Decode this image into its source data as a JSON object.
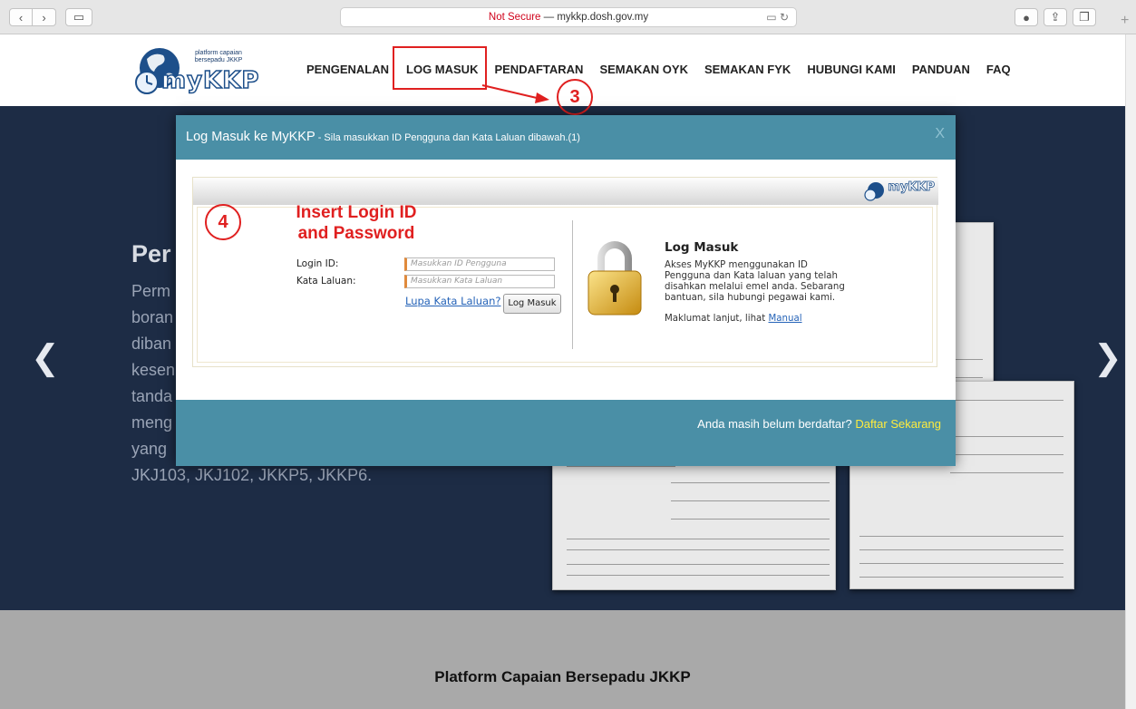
{
  "browser": {
    "not_secure": "Not Secure",
    "url_text": " — mykkp.dosh.gov.my"
  },
  "site": {
    "logo_caption_1": "platform capaian",
    "logo_caption_2": "bersepadu JKKP",
    "logo_text": "myKKP",
    "menu": [
      "PENGENALAN",
      "LOG MASUK",
      "PENDAFTARAN",
      "SEMAKAN OYK",
      "SEMAKAN FYK",
      "HUBUNGI KAMI",
      "PANDUAN",
      "FAQ"
    ]
  },
  "annotations": {
    "step3": "3",
    "step4": "4",
    "insert_note_1": "Insert Login ID",
    "insert_note_2": "and Password"
  },
  "hero": {
    "title": "Per",
    "lines": [
      "Perm",
      "boran",
      "diban",
      "kesen",
      "tanda",
      "meng",
      "yang",
      "JKJ103, JKJ102, JKKP5, JKKP6."
    ]
  },
  "modal": {
    "title": "Log Masuk ke MyKKP",
    "subtitle": " - Sila masukkan ID Pengguna dan Kata Laluan dibawah.",
    "title_suffix": "(1)",
    "close": "X",
    "login_id_label": "Login ID:",
    "login_id_placeholder": "Masukkan ID Pengguna",
    "password_label": "Kata Laluan:",
    "password_placeholder": "Masukkan Kata Laluan",
    "forgot": "Lupa Kata Laluan?",
    "login_button": "Log Masuk",
    "info_title": "Log Masuk",
    "info_text": "Akses MyKKP menggunakan ID Pengguna dan Kata laluan yang telah disahkan melalui emel anda. Sebarang bantuan, sila hubungi pegawai kami.",
    "info_more": "Maklumat lanjut, lihat ",
    "info_more_link": "Manual",
    "footer_text": "Anda masih belum berdaftar? ",
    "footer_link": "Daftar Sekarang",
    "mini_logo": "myKKP"
  },
  "footer": {
    "title": "Platform Capaian Bersepadu JKKP"
  },
  "colors": {
    "modal_header": "#4a8fa6",
    "hero_bg": "#1d2c45",
    "annotation_red": "#e02020",
    "link_yellow": "#ffec3d"
  }
}
